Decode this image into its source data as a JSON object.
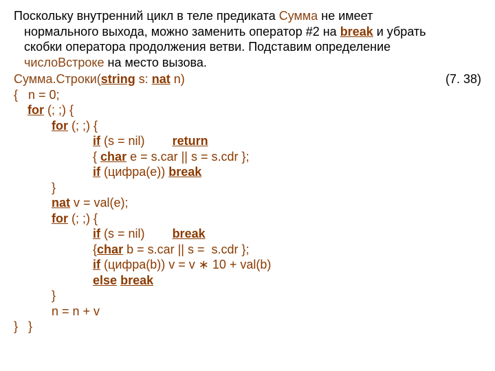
{
  "intro": {
    "l1a": "Поскольку внутренний цикл в теле предиката ",
    "l1b": "Сумма",
    "l1c": " не имеет",
    "l2a": "нормального выхода, можно заменить оператор #2 на ",
    "l2b": "break",
    "l2c": " и убрать",
    "l3": "скобки оператора продолжения ветви. Подставим определение",
    "l4a": "числоВстроке",
    "l4b": " на место вызова."
  },
  "sig": {
    "name": "Сумма.Строки(",
    "t1": "string",
    "s1": " s: ",
    "t2": "nat",
    "s2": " n)",
    "ref": "(7. 38)"
  },
  "code": {
    "l1a": "{   n = 0;",
    "l2a": "    ",
    "for": "for",
    "l2b": " (; ;) {",
    "l3a": "           ",
    "l3b": " (; ;) {",
    "l4a": "                       ",
    "if": "if",
    "l4b": " (s = nil)        ",
    "return": "return",
    "l5a": "                       { ",
    "char": "char",
    "l5b": " e = s.car || s = s.cdr };",
    "l6a": "                       ",
    "l6b": " (цифра(e)) ",
    "break": "break",
    "l7a": "           }",
    "l8a": "           ",
    "nat": "nat",
    "l8b": " v = val(e);",
    "l9a": "           ",
    "l9b": " (; ;) {",
    "l10a": "                       ",
    "l10b": " (s = nil)        ",
    "l11a": "                       {",
    "l11b": " b = s.car || s =  s.cdr };",
    "l12a": "                       ",
    "l12b": " (цифра(b)) v = v ∗ 10 + val(b)",
    "l13a": "                       ",
    "else": "else",
    "sp": " ",
    "l14a": "           }",
    "l15a": "           n = n + v",
    "l16a": "}   }"
  }
}
